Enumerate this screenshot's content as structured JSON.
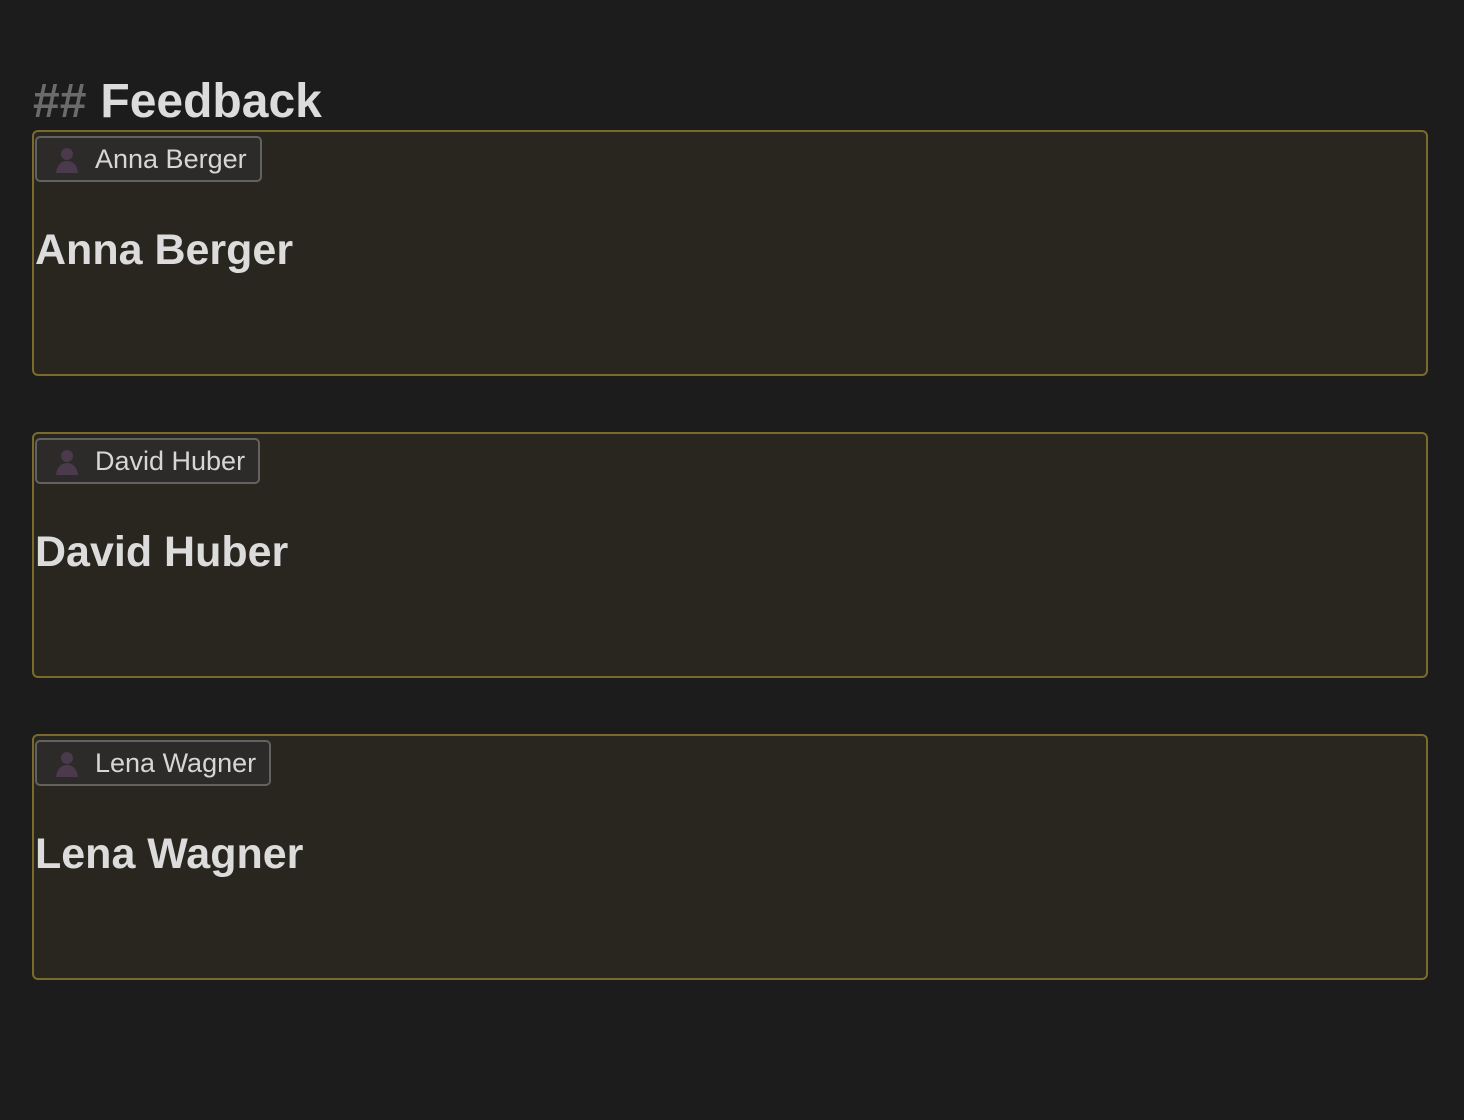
{
  "heading": {
    "marker": "##",
    "title": "Feedback"
  },
  "cards": [
    {
      "chip_label": "Anna Berger",
      "title": "Anna Berger",
      "avatar_icon": "person-icon"
    },
    {
      "chip_label": "David Huber",
      "title": "David Huber",
      "avatar_icon": "person-icon"
    },
    {
      "chip_label": "Lena Wagner",
      "title": "Lena Wagner",
      "avatar_icon": "person-icon"
    }
  ],
  "colors": {
    "background": "#1c1c1c",
    "card_background": "#29261f",
    "card_border": "#7a6a2c",
    "chip_border": "#62625f",
    "heading_marker": "#6b6b6b",
    "text": "#dcdcdc",
    "avatar": "#4a3a4c"
  }
}
